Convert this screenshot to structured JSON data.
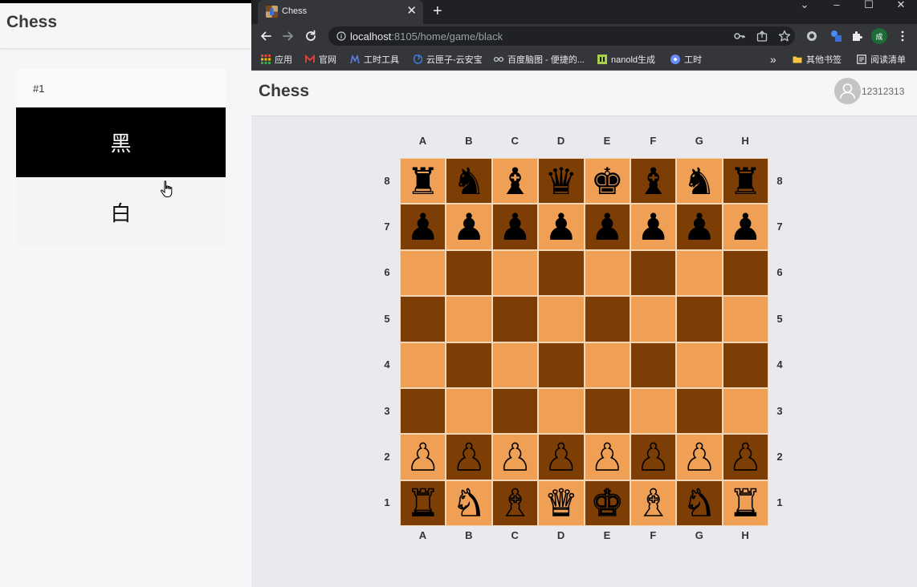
{
  "left_window": {
    "title": "Chess",
    "game_number": "#1",
    "side_black": "黑",
    "side_white": "白"
  },
  "browser": {
    "tab_title": "Chess",
    "tab_close": "✕",
    "new_tab": "+",
    "window_controls": [
      "⌄",
      "–",
      "☐",
      "✕"
    ],
    "url_host": "localhost",
    "url_rest": ":8105/home/game/black",
    "bookmarks": [
      "应用",
      "官网",
      "工时工具",
      "云匣子-云安宝",
      "百度脑图 - 便捷的...",
      "nanold生成",
      "工时"
    ],
    "bookmarks_overflow": "»",
    "other_bookmarks": "其他书签",
    "reading_list": "阅读清单",
    "profile_initial": "成"
  },
  "page": {
    "title": "Chess",
    "username": "12312313"
  },
  "board": {
    "files": [
      "A",
      "B",
      "C",
      "D",
      "E",
      "F",
      "G",
      "H"
    ],
    "ranks": [
      "8",
      "7",
      "6",
      "5",
      "4",
      "3",
      "2",
      "1"
    ],
    "light_color": "#f0a054",
    "dark_color": "#7d3e05",
    "position": [
      [
        "br",
        "bn",
        "bb",
        "bq",
        "bk",
        "bb",
        "bn",
        "br"
      ],
      [
        "bp",
        "bp",
        "bp",
        "bp",
        "bp",
        "bp",
        "bp",
        "bp"
      ],
      [
        "",
        "",
        "",
        "",
        "",
        "",
        "",
        ""
      ],
      [
        "",
        "",
        "",
        "",
        "",
        "",
        "",
        ""
      ],
      [
        "",
        "",
        "",
        "",
        "",
        "",
        "",
        ""
      ],
      [
        "",
        "",
        "",
        "",
        "",
        "",
        "",
        ""
      ],
      [
        "wp",
        "wp",
        "wp",
        "wp",
        "wp",
        "wp",
        "wp",
        "wp"
      ],
      [
        "wr",
        "wn",
        "wb",
        "wq",
        "wk",
        "wb",
        "wn",
        "wr"
      ]
    ]
  }
}
